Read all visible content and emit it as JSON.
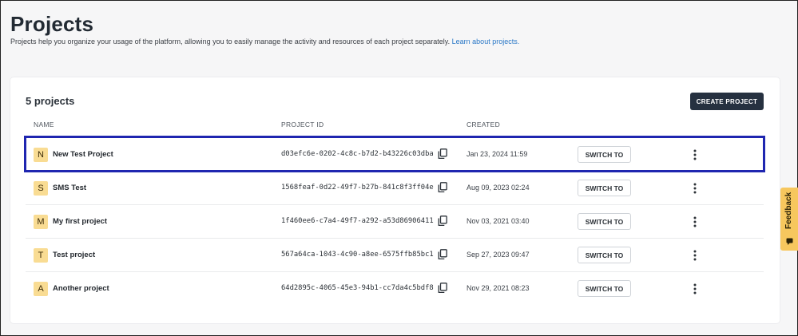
{
  "header": {
    "title": "Projects",
    "subtitle": "Projects help you organize your usage of the platform, allowing you to easily manage the activity and resources of each project separately.",
    "learn_link": "Learn about projects."
  },
  "card": {
    "count_label": "5 projects",
    "create_button": "CREATE PROJECT",
    "columns": {
      "name": "NAME",
      "project_id": "PROJECT ID",
      "created": "CREATED"
    },
    "switch_label": "SWITCH TO",
    "projects": [
      {
        "initial": "N",
        "name": "New Test Project",
        "id": "d03efc6e-0202-4c8c-b7d2-b43226c03dba",
        "created": "Jan 23, 2024 11:59",
        "selected": true
      },
      {
        "initial": "S",
        "name": "SMS Test",
        "id": "1568feaf-0d22-49f7-b27b-841c8f3ff04e",
        "created": "Aug 09, 2023 02:24",
        "selected": false
      },
      {
        "initial": "M",
        "name": "My first project",
        "id": "1f460ee6-c7a4-49f7-a292-a53d86906411",
        "created": "Nov 03, 2021 03:40",
        "selected": false
      },
      {
        "initial": "T",
        "name": "Test project",
        "id": "567a64ca-1043-4c90-a8ee-6575ffb85bc1",
        "created": "Sep 27, 2023 09:47",
        "selected": false
      },
      {
        "initial": "A",
        "name": "Another project",
        "id": "64d2895c-4065-45e3-94b1-cc7da4c5bdf8",
        "created": "Nov 29, 2021 08:23",
        "selected": false
      }
    ]
  },
  "feedback": {
    "label": "Feedback"
  },
  "icons": {
    "copy": "copy-icon",
    "more": "kebab-menu-icon",
    "feedback": "feedback-icon"
  },
  "colors": {
    "primary_button": "#263140",
    "avatar_bg": "#f9dc93",
    "link": "#2a78c7",
    "selection_outline": "#1f26b0",
    "feedback_tab": "#f7c75e"
  }
}
